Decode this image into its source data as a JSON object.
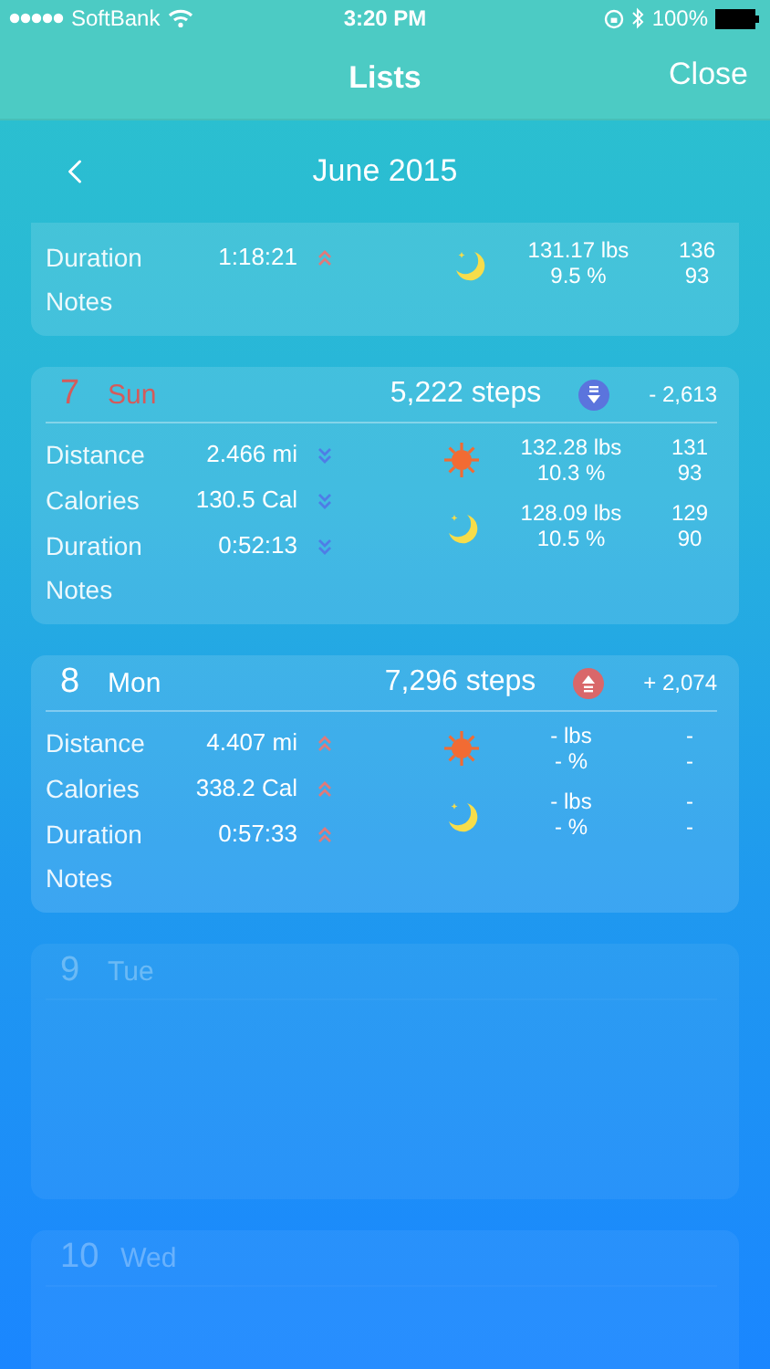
{
  "status_bar": {
    "carrier": "SoftBank",
    "time": "3:20 PM",
    "battery": "100%"
  },
  "nav": {
    "title": "Lists",
    "close": "Close"
  },
  "month": {
    "label": "June 2015"
  },
  "days": [
    {
      "kind": "partial",
      "metrics": [
        {
          "label": "Duration",
          "value": "1:18:21",
          "rising": true
        }
      ],
      "notes": "Notes",
      "readings": [
        {
          "kind": "night",
          "weight": "131.17 lbs",
          "fat": "9.5 %",
          "value_1": "136",
          "value_2": "93"
        }
      ]
    },
    {
      "kind": "full",
      "number": "7",
      "weekday": "Sun",
      "weekend": true,
      "steps": "5,222 steps",
      "steps_rising": false,
      "steps_delta": "- 2,613",
      "metrics": [
        {
          "label": "Distance",
          "value": "2.466 mi",
          "rising": false
        },
        {
          "label": "Calories",
          "value": "130.5 Cal",
          "rising": false
        },
        {
          "label": "Duration",
          "value": "0:52:13",
          "rising": false
        }
      ],
      "notes": "Notes",
      "readings": [
        {
          "kind": "day",
          "weight": "132.28 lbs",
          "fat": "10.3 %",
          "value_1": "131",
          "value_2": "93"
        },
        {
          "kind": "night",
          "weight": "128.09 lbs",
          "fat": "10.5 %",
          "value_1": "129",
          "value_2": "90"
        }
      ]
    },
    {
      "kind": "full",
      "number": "8",
      "weekday": "Mon",
      "weekend": false,
      "steps": "7,296 steps",
      "steps_rising": true,
      "steps_delta": "+ 2,074",
      "metrics": [
        {
          "label": "Distance",
          "value": "4.407 mi",
          "rising": true
        },
        {
          "label": "Calories",
          "value": "338.2 Cal",
          "rising": true
        },
        {
          "label": "Duration",
          "value": "0:57:33",
          "rising": true
        }
      ],
      "notes": "Notes",
      "readings": [
        {
          "kind": "day",
          "weight": "- lbs",
          "fat": "- %",
          "value_1": "-",
          "value_2": "-"
        },
        {
          "kind": "night",
          "weight": "- lbs",
          "fat": "- %",
          "value_1": "-",
          "value_2": "-"
        }
      ]
    },
    {
      "kind": "empty",
      "number": "9",
      "weekday": "Tue",
      "weekend": false
    },
    {
      "kind": "empty",
      "number": "10",
      "weekday": "Wed",
      "weekend": false
    }
  ]
}
